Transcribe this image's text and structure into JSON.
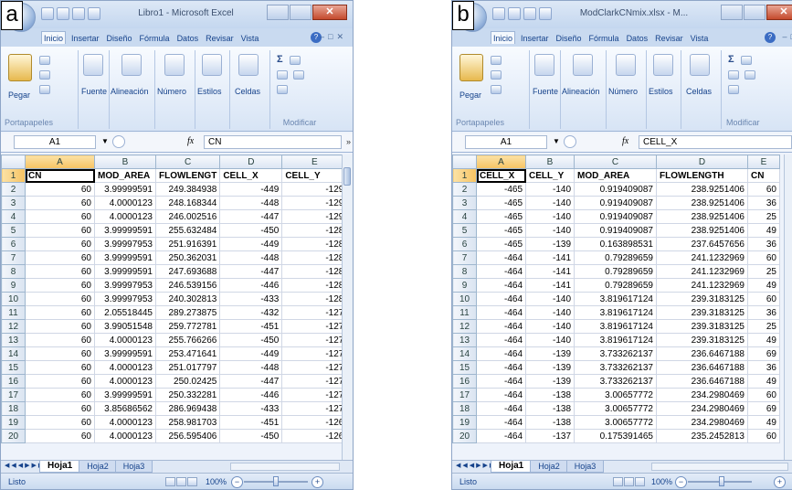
{
  "panel_a": {
    "letter": "a",
    "window_title": "Libro1 - Microsoft Excel",
    "tabs": [
      "Inicio",
      "Insertar",
      "Diseño",
      "Fórmula",
      "Datos",
      "Revisar",
      "Vista"
    ],
    "ribbon": {
      "paste": "Pegar",
      "font": "Fuente",
      "alignment": "Alineación",
      "number": "Número",
      "styles": "Estilos",
      "cells": "Celdas",
      "clipboard_group": "Portapapeles",
      "modify_group": "Modificar"
    },
    "name_box": "A1",
    "formula": "CN",
    "columns": [
      "A",
      "B",
      "C",
      "D",
      "E"
    ],
    "header_row": [
      "CN",
      "MOD_AREA",
      "FLOWLENGT",
      "CELL_X",
      "CELL_Y"
    ],
    "rows": [
      [
        "60",
        "3.99999591",
        "249.384938",
        "-449",
        "-129"
      ],
      [
        "60",
        "4.0000123",
        "248.168344",
        "-448",
        "-129"
      ],
      [
        "60",
        "4.0000123",
        "246.002516",
        "-447",
        "-129"
      ],
      [
        "60",
        "3.99999591",
        "255.632484",
        "-450",
        "-128"
      ],
      [
        "60",
        "3.99997953",
        "251.916391",
        "-449",
        "-128"
      ],
      [
        "60",
        "3.99999591",
        "250.362031",
        "-448",
        "-128"
      ],
      [
        "60",
        "3.99999591",
        "247.693688",
        "-447",
        "-128"
      ],
      [
        "60",
        "3.99997953",
        "246.539156",
        "-446",
        "-128"
      ],
      [
        "60",
        "3.99997953",
        "240.302813",
        "-433",
        "-128"
      ],
      [
        "60",
        "2.05518445",
        "289.273875",
        "-432",
        "-127"
      ],
      [
        "60",
        "3.99051548",
        "259.772781",
        "-451",
        "-127"
      ],
      [
        "60",
        "4.0000123",
        "255.766266",
        "-450",
        "-127"
      ],
      [
        "60",
        "3.99999591",
        "253.471641",
        "-449",
        "-127"
      ],
      [
        "60",
        "4.0000123",
        "251.017797",
        "-448",
        "-127"
      ],
      [
        "60",
        "4.0000123",
        "250.02425",
        "-447",
        "-127"
      ],
      [
        "60",
        "3.99999591",
        "250.332281",
        "-446",
        "-127"
      ],
      [
        "60",
        "3.85686562",
        "286.969438",
        "-433",
        "-127"
      ],
      [
        "60",
        "4.0000123",
        "258.981703",
        "-451",
        "-126"
      ],
      [
        "60",
        "4.0000123",
        "256.595406",
        "-450",
        "-126"
      ]
    ],
    "sheets": [
      "Hoja1",
      "Hoja2",
      "Hoja3"
    ],
    "status": "Listo",
    "zoom": "100%"
  },
  "panel_b": {
    "letter": "b",
    "window_title": "ModClarkCNmix.xlsx - M...",
    "tabs": [
      "Inicio",
      "Insertar",
      "Diseño",
      "Fórmula",
      "Datos",
      "Revisar",
      "Vista"
    ],
    "ribbon": {
      "paste": "Pegar",
      "font": "Fuente",
      "alignment": "Alineación",
      "number": "Número",
      "styles": "Estilos",
      "cells": "Celdas",
      "clipboard_group": "Portapapeles",
      "modify_group": "Modificar"
    },
    "name_box": "A1",
    "formula": "CELL_X",
    "columns": [
      "A",
      "B",
      "C",
      "D",
      "E"
    ],
    "header_row": [
      "CELL_X",
      "CELL_Y",
      "MOD_AREA",
      "FLOWLENGTH",
      "CN"
    ],
    "rows": [
      [
        "-465",
        "-140",
        "0.919409087",
        "238.9251406",
        "60"
      ],
      [
        "-465",
        "-140",
        "0.919409087",
        "238.9251406",
        "36"
      ],
      [
        "-465",
        "-140",
        "0.919409087",
        "238.9251406",
        "25"
      ],
      [
        "-465",
        "-140",
        "0.919409087",
        "238.9251406",
        "49"
      ],
      [
        "-465",
        "-139",
        "0.163898531",
        "237.6457656",
        "36"
      ],
      [
        "-464",
        "-141",
        "0.79289659",
        "241.1232969",
        "60"
      ],
      [
        "-464",
        "-141",
        "0.79289659",
        "241.1232969",
        "25"
      ],
      [
        "-464",
        "-141",
        "0.79289659",
        "241.1232969",
        "49"
      ],
      [
        "-464",
        "-140",
        "3.819617124",
        "239.3183125",
        "60"
      ],
      [
        "-464",
        "-140",
        "3.819617124",
        "239.3183125",
        "36"
      ],
      [
        "-464",
        "-140",
        "3.819617124",
        "239.3183125",
        "25"
      ],
      [
        "-464",
        "-140",
        "3.819617124",
        "239.3183125",
        "49"
      ],
      [
        "-464",
        "-139",
        "3.733262137",
        "236.6467188",
        "69"
      ],
      [
        "-464",
        "-139",
        "3.733262137",
        "236.6467188",
        "36"
      ],
      [
        "-464",
        "-139",
        "3.733262137",
        "236.6467188",
        "49"
      ],
      [
        "-464",
        "-138",
        "3.00657772",
        "234.2980469",
        "60"
      ],
      [
        "-464",
        "-138",
        "3.00657772",
        "234.2980469",
        "69"
      ],
      [
        "-464",
        "-138",
        "3.00657772",
        "234.2980469",
        "49"
      ],
      [
        "-464",
        "-137",
        "0.175391465",
        "235.2452813",
        "60"
      ]
    ],
    "sheets": [
      "Hoja1",
      "Hoja2",
      "Hoja3"
    ],
    "status": "Listo",
    "zoom": "100%"
  }
}
